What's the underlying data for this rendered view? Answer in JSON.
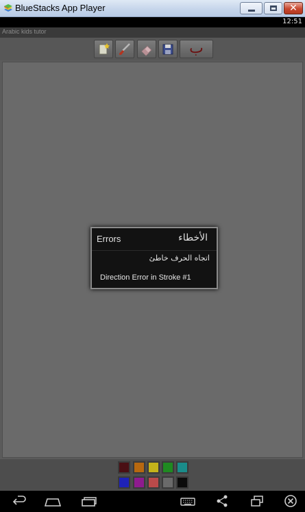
{
  "window": {
    "title": "BlueStacks App Player",
    "close_glyph": "✕"
  },
  "statusbar": {
    "time": "12:51"
  },
  "app": {
    "title": "Arabic kids tutor"
  },
  "toolbar": {
    "items": [
      "new-page-icon",
      "brush-icon",
      "eraser-icon",
      "save-icon"
    ],
    "letter": "ب"
  },
  "palette": {
    "row1": [
      "#4a0f14",
      "#b76810",
      "#c4b31a",
      "#1f8a21",
      "#1a8c8a"
    ],
    "row2": [
      "#1e22b8",
      "#8e1b8e",
      "#b94a4a",
      "#6a6a6a",
      "#0b0b0b"
    ]
  },
  "dialog": {
    "title_en": "Errors",
    "title_ar": "الأخطاء",
    "message_ar": "اتجاه الحرف خاطئ",
    "message_en": "Direction Error in Stroke #1"
  },
  "navbar": {
    "icons": [
      "back-icon",
      "home-icon",
      "recent-apps-icon",
      "keyboard-icon",
      "share-icon",
      "rotate-screen-icon",
      "close-app-icon"
    ]
  }
}
